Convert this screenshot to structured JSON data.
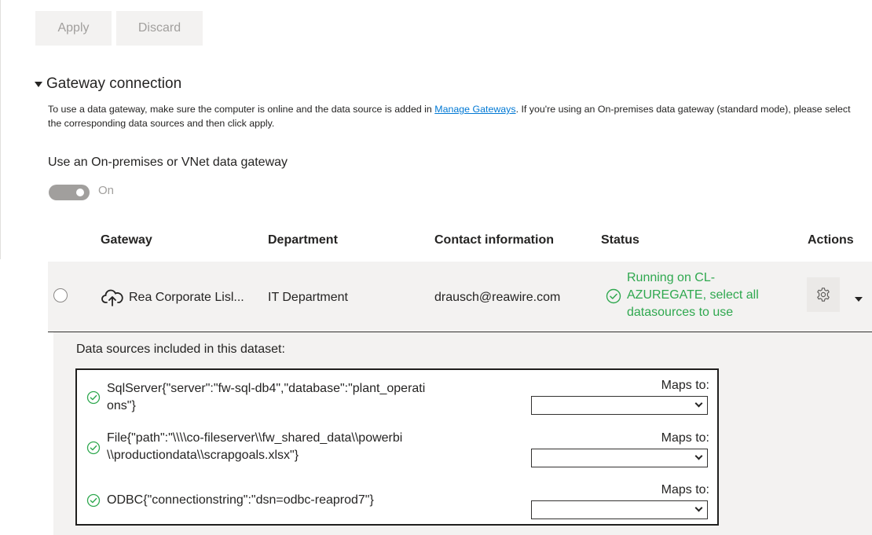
{
  "toolbar": {
    "apply_label": "Apply",
    "discard_label": "Discard"
  },
  "section": {
    "title": "Gateway connection",
    "description_before_link": "To use a data gateway, make sure the computer is online and the data source is added in ",
    "link_text": "Manage Gateways",
    "description_after_link": ". If you're using an On-premises data gateway (standard mode), please select the corresponding data sources and then click apply."
  },
  "gateway_toggle": {
    "label": "Use an On-premises or VNet data gateway",
    "state_text": "On",
    "on": true
  },
  "table": {
    "headers": {
      "gateway": "Gateway",
      "department": "Department",
      "contact": "Contact information",
      "status": "Status",
      "actions": "Actions"
    },
    "row": {
      "gateway_name": "Rea Corporate Lisl...",
      "department": "IT Department",
      "contact": "drausch@reawire.com",
      "status_lines": [
        "Running on CL-",
        "AZUREGATE, select all",
        "datasources to use"
      ]
    }
  },
  "data_sources": {
    "title": "Data sources included in this dataset:",
    "maps_to_label": "Maps to:",
    "items": [
      {
        "lines": [
          "SqlServer{\"server\":\"fw-sql-db4\",\"database\":\"plant_operati",
          "ons\"}"
        ],
        "maps_to_value": ""
      },
      {
        "lines": [
          "File{\"path\":\"\\\\\\\\co-fileserver\\\\fw_shared_data\\\\powerbi",
          "\\\\productiondata\\\\scrapgoals.xlsx\"}"
        ],
        "maps_to_value": ""
      },
      {
        "lines": [
          "ODBC{\"connectionstring\":\"dsn=odbc-reaprod7\"}"
        ],
        "maps_to_value": ""
      }
    ]
  },
  "colors": {
    "success": "#2fa84f",
    "link": "#0078d4",
    "row_bg": "#f3f2f1"
  },
  "icons": {
    "gateway": "cloud-upload-icon",
    "status": "check-circle-icon",
    "actions": "gear-icon",
    "expand": "chevron-down-icon"
  }
}
